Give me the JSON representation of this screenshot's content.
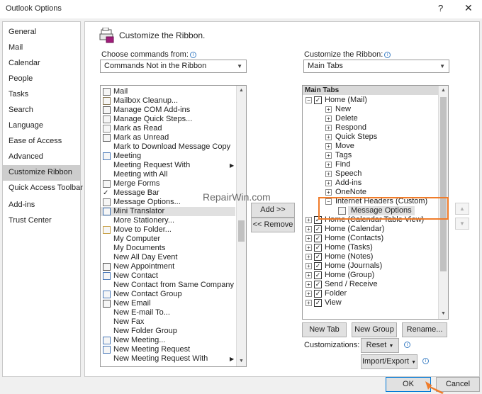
{
  "window": {
    "title": "Outlook Options",
    "help": "?",
    "close": "✕"
  },
  "nav": {
    "items": [
      {
        "label": "General",
        "selected": false
      },
      {
        "label": "Mail",
        "selected": false
      },
      {
        "label": "Calendar",
        "selected": false
      },
      {
        "label": "People",
        "selected": false
      },
      {
        "label": "Tasks",
        "selected": false
      },
      {
        "label": "Search",
        "selected": false
      },
      {
        "label": "Language",
        "selected": false
      },
      {
        "label": "Ease of Access",
        "selected": false
      },
      {
        "label": "Advanced",
        "selected": false
      },
      {
        "label": "Customize Ribbon",
        "selected": true
      },
      {
        "label": "Quick Access Toolbar",
        "selected": false
      },
      {
        "label": "Add-ins",
        "selected": false
      },
      {
        "label": "Trust Center",
        "selected": false
      }
    ]
  },
  "header": {
    "title": "Customize the Ribbon."
  },
  "left": {
    "label": "Choose commands from:",
    "combo_value": "Commands Not in the Ribbon",
    "commands": [
      {
        "label": "Mail",
        "icon": "mail-icon",
        "submenu": false
      },
      {
        "label": "Mailbox Cleanup...",
        "icon": "cleanup-icon",
        "submenu": false
      },
      {
        "label": "Manage COM Add-ins",
        "icon": "addins-icon",
        "submenu": false
      },
      {
        "label": "Manage Quick Steps...",
        "icon": "quicksteps-icon",
        "submenu": false
      },
      {
        "label": "Mark as Read",
        "icon": "envelope-open-icon",
        "submenu": false
      },
      {
        "label": "Mark as Unread",
        "icon": "envelope-icon",
        "submenu": false
      },
      {
        "label": "Mark to Download Message Copy",
        "icon": "",
        "submenu": false
      },
      {
        "label": "Meeting",
        "icon": "meeting-icon",
        "submenu": false
      },
      {
        "label": "Meeting Request With",
        "icon": "",
        "submenu": true
      },
      {
        "label": "Meeting with All",
        "icon": "",
        "submenu": false
      },
      {
        "label": "Merge Forms",
        "icon": "merge-icon",
        "submenu": false
      },
      {
        "label": "Message Bar",
        "icon": "checkmark-icon",
        "submenu": false
      },
      {
        "label": "Message Options...",
        "icon": "options-icon",
        "submenu": false
      },
      {
        "label": "Mini Translator",
        "icon": "translator-icon",
        "submenu": false,
        "selected": true
      },
      {
        "label": "More Stationery...",
        "icon": "",
        "submenu": false
      },
      {
        "label": "Move to Folder...",
        "icon": "folder-icon",
        "submenu": false
      },
      {
        "label": "My Computer",
        "icon": "",
        "submenu": false
      },
      {
        "label": "My Documents",
        "icon": "",
        "submenu": false
      },
      {
        "label": "New All Day Event",
        "icon": "",
        "submenu": false
      },
      {
        "label": "New Appointment",
        "icon": "calendar-icon",
        "submenu": false
      },
      {
        "label": "New Contact",
        "icon": "contact-icon",
        "submenu": false
      },
      {
        "label": "New Contact from Same Company",
        "icon": "",
        "submenu": false
      },
      {
        "label": "New Contact Group",
        "icon": "contact-group-icon",
        "submenu": false
      },
      {
        "label": "New Email",
        "icon": "email-icon",
        "submenu": false
      },
      {
        "label": "New E-mail To...",
        "icon": "",
        "submenu": false
      },
      {
        "label": "New Fax",
        "icon": "",
        "submenu": false
      },
      {
        "label": "New Folder Group",
        "icon": "",
        "submenu": false
      },
      {
        "label": "New Meeting...",
        "icon": "meeting-icon",
        "submenu": false
      },
      {
        "label": "New Meeting Request",
        "icon": "meeting-icon",
        "submenu": false
      },
      {
        "label": "New Meeting Request With",
        "icon": "",
        "submenu": true
      }
    ]
  },
  "right": {
    "label": "Customize the Ribbon:",
    "combo_value": "Main Tabs",
    "tree_header": "Main Tabs",
    "tree": [
      {
        "label": "Home (Mail)",
        "level": 0,
        "expander": "⊟",
        "checked": true
      },
      {
        "label": "New",
        "level": 1,
        "expander": "⊞"
      },
      {
        "label": "Delete",
        "level": 1,
        "expander": "⊞"
      },
      {
        "label": "Respond",
        "level": 1,
        "expander": "⊞"
      },
      {
        "label": "Quick Steps",
        "level": 1,
        "expander": "⊞"
      },
      {
        "label": "Move",
        "level": 1,
        "expander": "⊞"
      },
      {
        "label": "Tags",
        "level": 1,
        "expander": "⊞"
      },
      {
        "label": "Find",
        "level": 1,
        "expander": "⊞"
      },
      {
        "label": "Speech",
        "level": 1,
        "expander": "⊞"
      },
      {
        "label": "Add-ins",
        "level": 1,
        "expander": "⊞"
      },
      {
        "label": "OneNote",
        "level": 1,
        "expander": "⊞"
      },
      {
        "label": "Internet Headers (Custom)",
        "level": 1,
        "expander": "⊟"
      },
      {
        "label": "Message Options",
        "level": 2,
        "expander": "",
        "selected": true
      },
      {
        "label": "Home (Calendar Table View)",
        "level": 0,
        "expander": "⊞",
        "checked": true
      },
      {
        "label": "Home (Calendar)",
        "level": 0,
        "expander": "⊞",
        "checked": true
      },
      {
        "label": "Home (Contacts)",
        "level": 0,
        "expander": "⊞",
        "checked": true
      },
      {
        "label": "Home (Tasks)",
        "level": 0,
        "expander": "⊞",
        "checked": true
      },
      {
        "label": "Home (Notes)",
        "level": 0,
        "expander": "⊞",
        "checked": true
      },
      {
        "label": "Home (Journals)",
        "level": 0,
        "expander": "⊞",
        "checked": true
      },
      {
        "label": "Home (Group)",
        "level": 0,
        "expander": "⊞",
        "checked": true
      },
      {
        "label": "Send / Receive",
        "level": 0,
        "expander": "⊞",
        "checked": true
      },
      {
        "label": "Folder",
        "level": 0,
        "expander": "⊞",
        "checked": true
      },
      {
        "label": "View",
        "level": 0,
        "expander": "⊞",
        "checked": true
      }
    ],
    "new_tab": "New Tab",
    "new_group": "New Group",
    "rename": "Rename...",
    "customizations_label": "Customizations:",
    "reset": "Reset",
    "import_export": "Import/Export"
  },
  "middle": {
    "add": "Add >>",
    "remove": "<< Remove"
  },
  "footer": {
    "ok": "OK",
    "cancel": "Cancel"
  },
  "watermark": "RepairWin.com",
  "colors": {
    "highlight": "#f07c2a",
    "selected_nav": "#cdcdcd",
    "accent": "#0078d7"
  }
}
